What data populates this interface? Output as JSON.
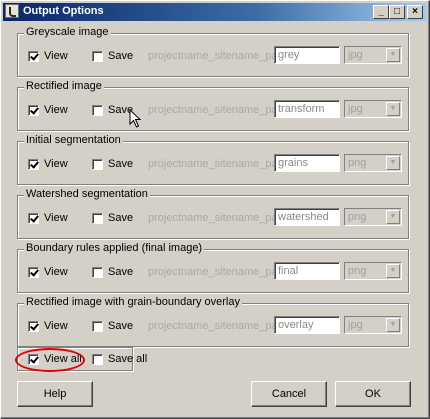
{
  "window": {
    "title": "Output Options",
    "minimize_glyph": "_",
    "maximize_glyph": "□",
    "close_glyph": "×"
  },
  "common": {
    "view_label": "View",
    "save_label": "Save",
    "pattern": "projectname_sitename_patchID_",
    "dropdown_arrow": "▼"
  },
  "groups": [
    {
      "title": "Greyscale image",
      "view_checked": true,
      "save_checked": false,
      "suffix": "grey",
      "format": "jpg"
    },
    {
      "title": "Rectified image",
      "view_checked": true,
      "save_checked": false,
      "suffix": "transform",
      "format": "jpg"
    },
    {
      "title": "Initial segmentation",
      "view_checked": true,
      "save_checked": false,
      "suffix": "grains",
      "format": "png"
    },
    {
      "title": "Watershed segmentation",
      "view_checked": true,
      "save_checked": false,
      "suffix": "watershed",
      "format": "png"
    },
    {
      "title": "Boundary rules applied (final image)",
      "view_checked": true,
      "save_checked": false,
      "suffix": "final",
      "format": "png"
    },
    {
      "title": "Rectified image with grain-boundary overlay",
      "view_checked": true,
      "save_checked": false,
      "suffix": "overlay",
      "format": "jpg"
    }
  ],
  "bottom": {
    "view_all_label": "View all",
    "view_all_checked": true,
    "save_all_label": "Save all",
    "save_all_checked": false
  },
  "buttons": {
    "help": "Help",
    "cancel": "Cancel",
    "ok": "OK"
  },
  "colors": {
    "title_bar": "#0a246a",
    "annotation": "#e00000",
    "face": "#d4d0c8"
  }
}
